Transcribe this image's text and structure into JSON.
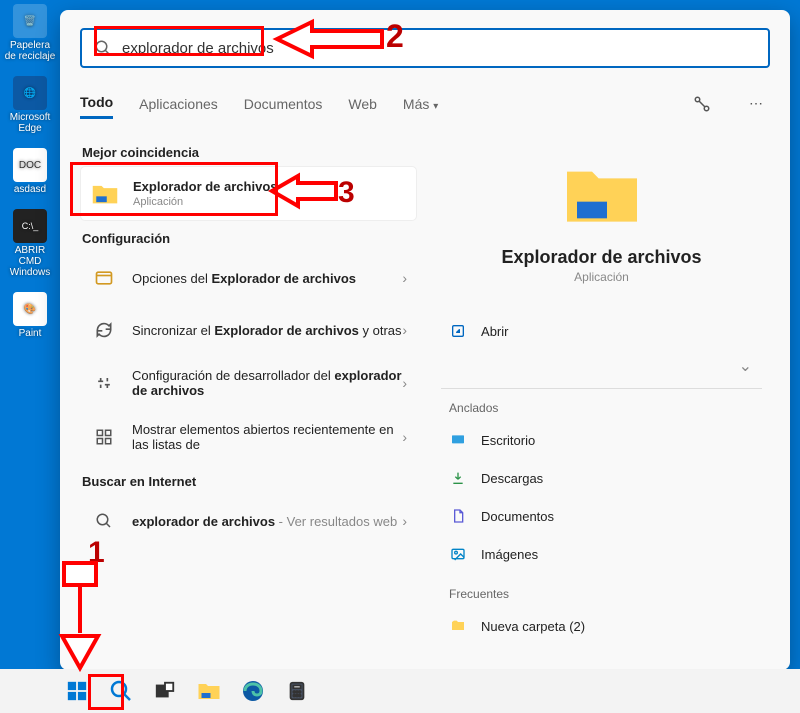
{
  "desktop": {
    "icons": [
      {
        "label": "Papelera de reciclaje"
      },
      {
        "label": "Microsoft Edge"
      },
      {
        "label": "asdasd"
      },
      {
        "label": "ABRIR CMD Windows"
      },
      {
        "label": "Paint"
      }
    ]
  },
  "search": {
    "value": "explorador de archivos",
    "placeholder": ""
  },
  "tabs": {
    "items": [
      {
        "label": "Todo",
        "active": true
      },
      {
        "label": "Aplicaciones"
      },
      {
        "label": "Documentos"
      },
      {
        "label": "Web"
      },
      {
        "label": "Más"
      }
    ]
  },
  "sections": {
    "best_match": "Mejor coincidencia",
    "best_item": {
      "title": "Explorador de archivos",
      "subtitle": "Aplicación"
    },
    "configuracion": "Configuración",
    "config_items": [
      {
        "prefix": "Opciones del ",
        "bold": "Explorador de archivos",
        "suffix": ""
      },
      {
        "prefix": "Sincronizar el ",
        "bold": "Explorador de archivos",
        "suffix": " y otras"
      },
      {
        "prefix": "Configuración de desarrollador del ",
        "bold": "explorador de archivos",
        "suffix": ""
      },
      {
        "prefix": "Mostrar elementos abiertos recientemente en las listas de",
        "bold": "",
        "suffix": ""
      }
    ],
    "web_search": "Buscar en Internet",
    "web_item": {
      "prefix": "explorador de archivos",
      "suffix": " - Ver resultados web"
    }
  },
  "detail": {
    "title": "Explorador de archivos",
    "subtitle": "Aplicación",
    "open_label": "Abrir",
    "pinned_head": "Anclados",
    "pinned": [
      {
        "label": "Escritorio"
      },
      {
        "label": "Descargas"
      },
      {
        "label": "Documentos"
      },
      {
        "label": "Imágenes"
      }
    ],
    "frequent_head": "Frecuentes",
    "frequent": [
      {
        "label": "Nueva carpeta (2)"
      }
    ]
  },
  "annotations": {
    "n1": "1",
    "n2": "2",
    "n3": "3"
  }
}
